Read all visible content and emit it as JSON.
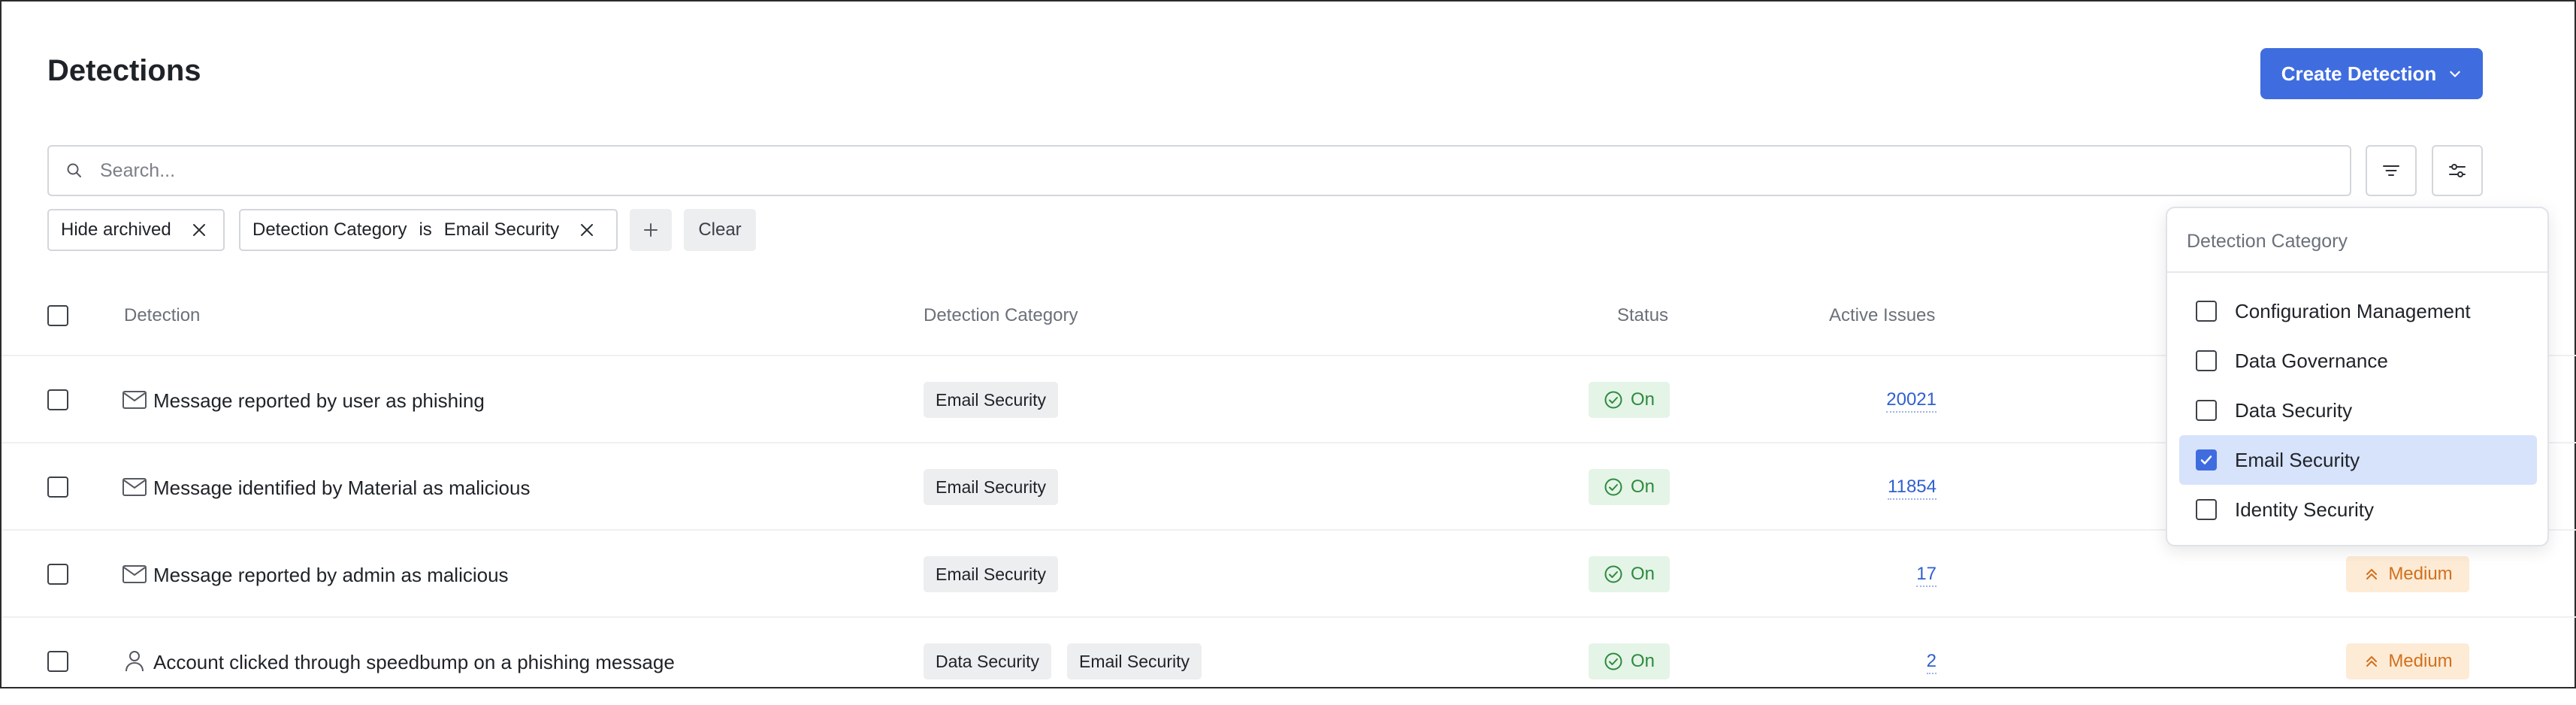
{
  "page": {
    "title": "Detections",
    "create_button": "Create Detection"
  },
  "search": {
    "placeholder": "Search..."
  },
  "filters": {
    "hide_archived": "Hide archived",
    "category_filter": {
      "field": "Detection Category",
      "op": "is",
      "value": "Email Security"
    },
    "clear_label": "Clear"
  },
  "table": {
    "columns": {
      "detection": "Detection",
      "category": "Detection Category",
      "status": "Status",
      "active_issues": "Active Issues"
    },
    "rows": [
      {
        "icon": "mail-icon",
        "name": "Message reported by user as phishing",
        "categories": [
          "Email Security"
        ],
        "status": "On",
        "active_issues": "20021",
        "severity": ""
      },
      {
        "icon": "mail-icon",
        "name": "Message identified by Material as malicious",
        "categories": [
          "Email Security"
        ],
        "status": "On",
        "active_issues": "11854",
        "severity": ""
      },
      {
        "icon": "mail-icon",
        "name": "Message reported by admin as malicious",
        "categories": [
          "Email Security"
        ],
        "status": "On",
        "active_issues": "17",
        "severity": "Medium"
      },
      {
        "icon": "user-icon",
        "name": "Account clicked through speedbump on a phishing message",
        "categories": [
          "Data Security",
          "Email Security"
        ],
        "status": "On",
        "active_issues": "2",
        "severity": "Medium"
      }
    ]
  },
  "category_dropdown": {
    "header": "Detection Category",
    "options": [
      {
        "label": "Configuration Management",
        "checked": false
      },
      {
        "label": "Data Governance",
        "checked": false
      },
      {
        "label": "Data Security",
        "checked": false
      },
      {
        "label": "Email Security",
        "checked": true
      },
      {
        "label": "Identity Security",
        "checked": false
      }
    ]
  },
  "colors": {
    "primary": "#3f6ddf",
    "status_on_bg": "#e4f4e7",
    "status_on_text": "#2e8a3e",
    "severity_medium_bg": "#fdebd6",
    "severity_medium_text": "#d2701c",
    "link": "#2f5fd0"
  }
}
